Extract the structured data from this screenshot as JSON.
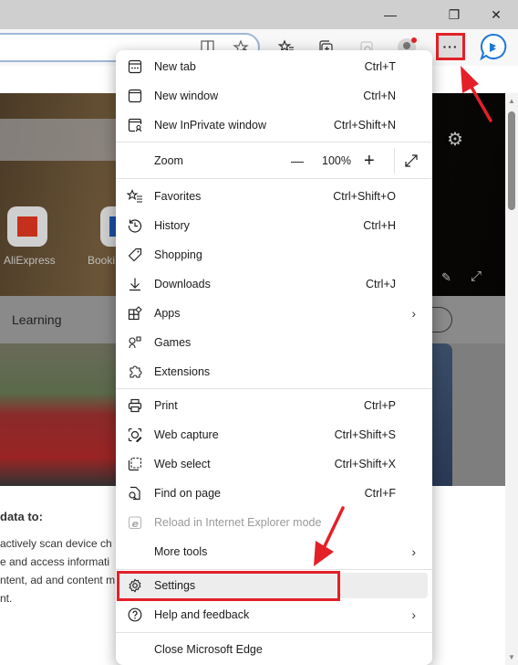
{
  "window": {
    "controls": {
      "minimize": "—",
      "restore": "❐",
      "close": "✕"
    }
  },
  "toolbar": {
    "more_button_label": "···",
    "icons": [
      "reading-view-icon",
      "favorite-add-icon",
      "favorites-icon",
      "collections-icon",
      "extension-icon",
      "profile-icon",
      "more-icon",
      "bing-copilot-icon"
    ]
  },
  "page": {
    "tiles": [
      {
        "label": "AliExpress",
        "color": "#c4301b"
      },
      {
        "label": "Booki",
        "color": "#1a4fa3"
      }
    ],
    "category": "Learning",
    "consent": {
      "heading": "data to:",
      "lines": [
        " actively scan device ch",
        "e and access informati",
        "ntent, ad and content m",
        "nt."
      ]
    }
  },
  "menu": {
    "items": [
      {
        "label": "New tab",
        "shortcut": "Ctrl+T",
        "icon": "new-tab-icon"
      },
      {
        "label": "New window",
        "shortcut": "Ctrl+N",
        "icon": "new-window-icon"
      },
      {
        "label": "New InPrivate window",
        "shortcut": "Ctrl+Shift+N",
        "icon": "inprivate-icon"
      },
      {
        "label": "Favorites",
        "shortcut": "Ctrl+Shift+O",
        "icon": "favorites-icon"
      },
      {
        "label": "History",
        "shortcut": "Ctrl+H",
        "icon": "history-icon"
      },
      {
        "label": "Shopping",
        "shortcut": "",
        "icon": "shopping-tag-icon"
      },
      {
        "label": "Downloads",
        "shortcut": "Ctrl+J",
        "icon": "download-icon"
      },
      {
        "label": "Apps",
        "shortcut": "",
        "icon": "apps-icon",
        "submenu": true
      },
      {
        "label": "Games",
        "shortcut": "",
        "icon": "games-icon"
      },
      {
        "label": "Extensions",
        "shortcut": "",
        "icon": "extensions-icon"
      },
      {
        "label": "Print",
        "shortcut": "Ctrl+P",
        "icon": "print-icon"
      },
      {
        "label": "Web capture",
        "shortcut": "Ctrl+Shift+S",
        "icon": "web-capture-icon"
      },
      {
        "label": "Web select",
        "shortcut": "Ctrl+Shift+X",
        "icon": "web-select-icon"
      },
      {
        "label": "Find on page",
        "shortcut": "Ctrl+F",
        "icon": "find-icon"
      },
      {
        "label": "Reload in Internet Explorer mode",
        "shortcut": "",
        "icon": "ie-icon",
        "disabled": true
      },
      {
        "label": "More tools",
        "shortcut": "",
        "icon": "",
        "submenu": true
      },
      {
        "label": "Settings",
        "shortcut": "",
        "icon": "settings-gear-icon",
        "highlighted": true
      },
      {
        "label": "Help and feedback",
        "shortcut": "",
        "icon": "help-icon",
        "submenu": true
      },
      {
        "label": "Close Microsoft Edge",
        "shortcut": "",
        "icon": ""
      }
    ],
    "zoom": {
      "label": "Zoom",
      "value": "100%",
      "minus": "—",
      "plus": "+"
    },
    "chevron": "›"
  },
  "annotation": {
    "color": "#e32028"
  }
}
